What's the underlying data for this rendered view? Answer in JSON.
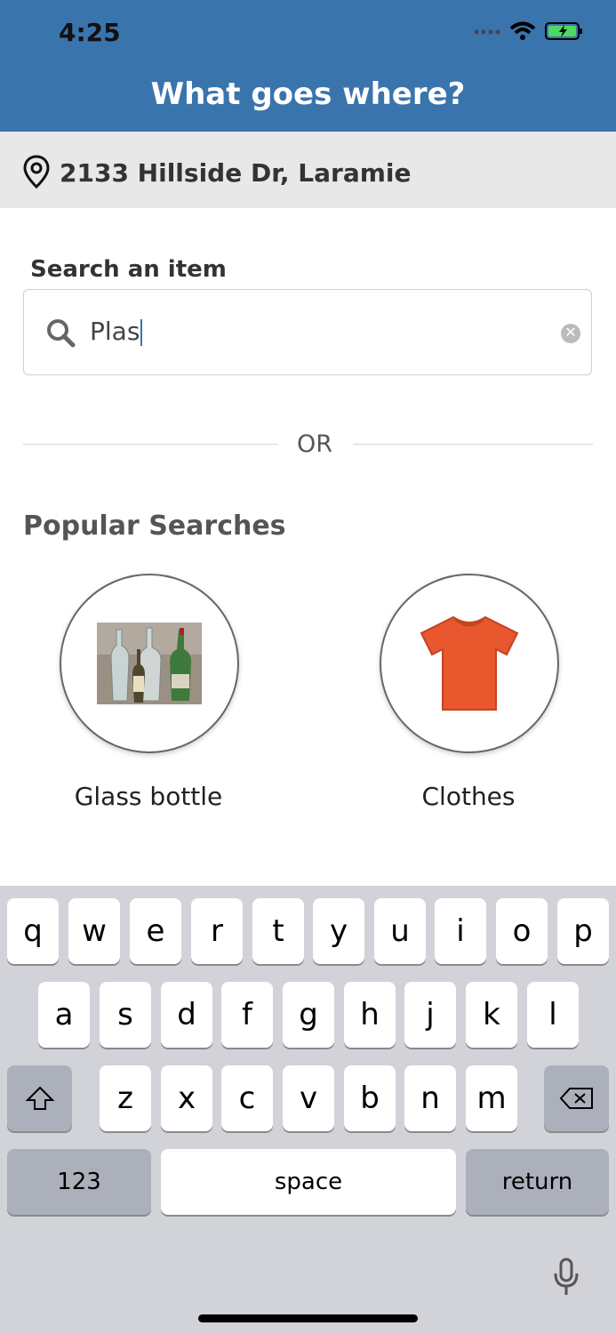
{
  "status_bar": {
    "time": "4:25"
  },
  "header": {
    "title": "What goes where?"
  },
  "location": {
    "address": "2133 Hillside Dr, Laramie"
  },
  "search": {
    "label": "Search an item",
    "value": "Plas"
  },
  "divider": {
    "text": "OR"
  },
  "popular": {
    "title": "Popular Searches",
    "items": [
      {
        "label": "Glass bottle",
        "icon": "glass-bottles-photo"
      },
      {
        "label": "Clothes",
        "icon": "orange-tshirt-photo"
      }
    ]
  },
  "keyboard": {
    "row1": [
      "q",
      "w",
      "e",
      "r",
      "t",
      "y",
      "u",
      "i",
      "o",
      "p"
    ],
    "row2": [
      "a",
      "s",
      "d",
      "f",
      "g",
      "h",
      "j",
      "k",
      "l"
    ],
    "row3": [
      "z",
      "x",
      "c",
      "v",
      "b",
      "n",
      "m"
    ],
    "numbers_label": "123",
    "space_label": "space",
    "return_label": "return"
  },
  "colors": {
    "header_bg": "#3a74ad",
    "location_bg": "#e8e8e8",
    "keyboard_bg": "#d1d3d9"
  }
}
